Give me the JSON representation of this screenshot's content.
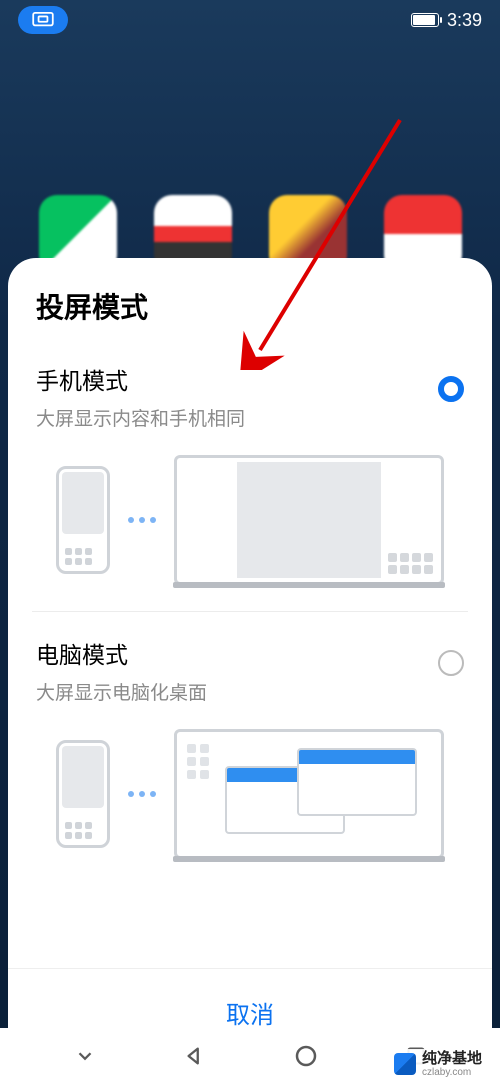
{
  "status": {
    "time": "3:39"
  },
  "modal": {
    "title": "投屏模式",
    "options": [
      {
        "title": "手机模式",
        "desc": "大屏显示内容和手机相同",
        "selected": true
      },
      {
        "title": "电脑模式",
        "desc": "大屏显示电脑化桌面",
        "selected": false
      }
    ],
    "cancel": "取消"
  },
  "watermark": {
    "title": "纯净基地",
    "url": "czlaby.com"
  }
}
